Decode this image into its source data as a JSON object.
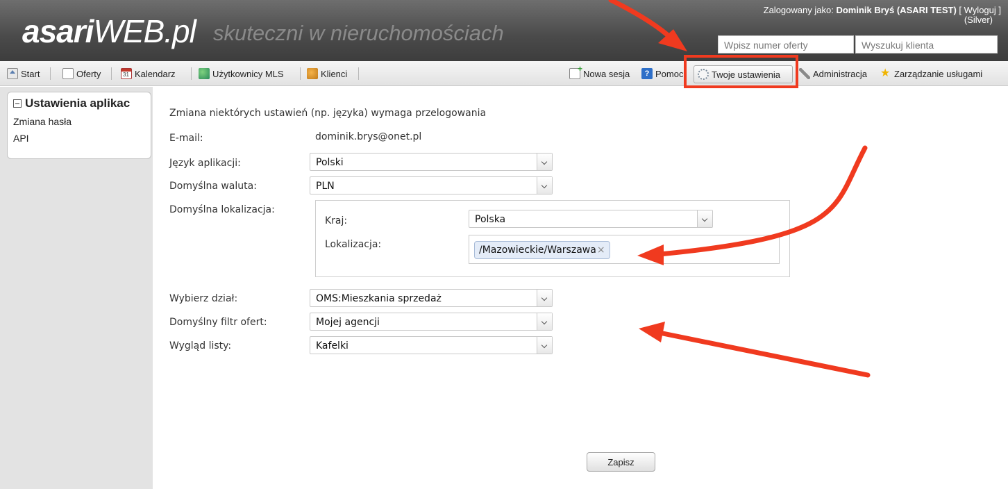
{
  "header": {
    "logo_bold": "asari",
    "logo_rest": "WEB.pl",
    "tagline": "skuteczni w nieruchomościach",
    "logged_prefix": "Zalogowany jako:",
    "user_name": "Dominik Bryś (ASARI TEST)",
    "logout": "[ Wyloguj ]",
    "plan": "(Silver)",
    "offer_search_placeholder": "Wpisz numer oferty",
    "client_search_placeholder": "Wyszukuj klienta"
  },
  "toolbar": {
    "start": "Start",
    "offers": "Oferty",
    "calendar": "Kalendarz",
    "calendar_icon_text": "31",
    "mls_users": "Użytkownicy MLS",
    "clients": "Klienci",
    "new_session": "Nowa sesja",
    "help": "Pomoc",
    "your_settings": "Twoje ustawienia",
    "administration": "Administracja",
    "services": "Zarządzanie usługami"
  },
  "sidebar": {
    "section": "Ustawienia aplikac",
    "items": [
      {
        "label": "Zmiana hasła"
      },
      {
        "label": "API"
      }
    ]
  },
  "form": {
    "hint": "Zmiana niektórych ustawień (np. języka) wymaga przelogowania",
    "email_label": "E-mail:",
    "email_value": "dominik.brys@onet.pl",
    "language_label": "Język aplikacji:",
    "language_value": "Polski",
    "currency_label": "Domyślna waluta:",
    "currency_value": "PLN",
    "location_label": "Domyślna lokalizacja:",
    "country_label": "Kraj:",
    "country_value": "Polska",
    "locality_label": "Lokalizacja:",
    "locality_tag": "/Mazowieckie/Warszawa",
    "tag_remove": "×",
    "department_label": "Wybierz dział:",
    "department_value": "OMS:Mieszkania sprzedaż",
    "filter_label": "Domyślny filtr ofert:",
    "filter_value": "Mojej agencji",
    "list_view_label": "Wygląd listy:",
    "list_view_value": "Kafelki",
    "save": "Zapisz"
  },
  "colors": {
    "annotation": "#f03a1f",
    "header_bg": "#4a4a4a"
  }
}
